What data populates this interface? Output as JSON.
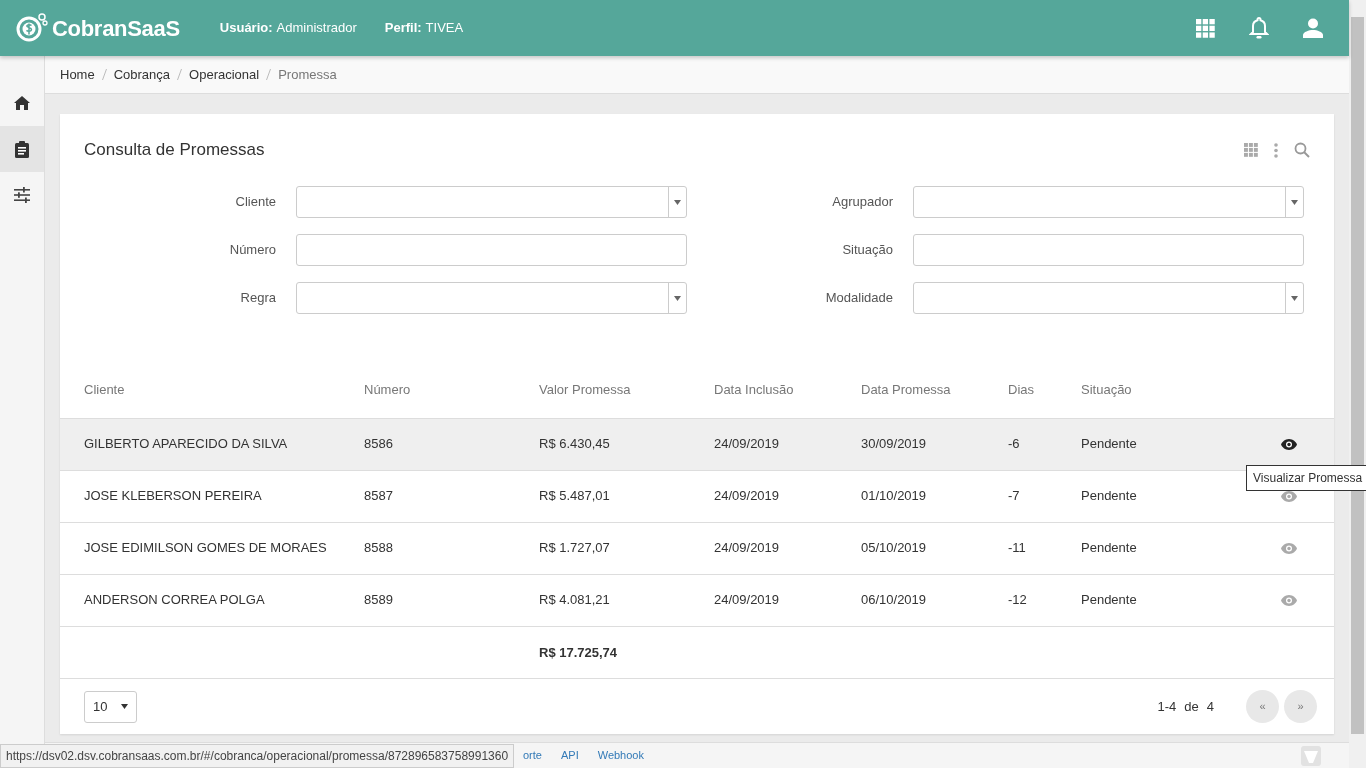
{
  "header": {
    "brand": "CobranSaaS",
    "user_label": "Usuário:",
    "user_value": "Administrador",
    "profile_label": "Perfil:",
    "profile_value": "TIVEA"
  },
  "breadcrumb": [
    {
      "label": "Home",
      "active": false
    },
    {
      "label": "Cobrança",
      "active": false
    },
    {
      "label": "Operacional",
      "active": false
    },
    {
      "label": "Promessa",
      "active": true
    }
  ],
  "sidebar": {
    "items": [
      {
        "kind": "home",
        "selected": false
      },
      {
        "kind": "clipboard",
        "selected": true
      },
      {
        "kind": "sliders",
        "selected": false
      }
    ]
  },
  "card": {
    "title": "Consulta de Promessas"
  },
  "filters": [
    {
      "label": "Cliente",
      "kind": "select"
    },
    {
      "label": "Agrupador",
      "kind": "select"
    },
    {
      "label": "Número",
      "kind": "text"
    },
    {
      "label": "Situação",
      "kind": "text"
    },
    {
      "label": "Regra",
      "kind": "select"
    },
    {
      "label": "Modalidade",
      "kind": "select"
    }
  ],
  "table": {
    "columns": [
      "Cliente",
      "Número",
      "Valor Promessa",
      "Data Inclusão",
      "Data Promessa",
      "Dias",
      "Situação"
    ],
    "rows": [
      {
        "cells": [
          "GILBERTO APARECIDO DA SILVA",
          "8586",
          "R$ 6.430,45",
          "24/09/2019",
          "30/09/2019",
          "-6",
          "Pendente"
        ],
        "hovered": true
      },
      {
        "cells": [
          "JOSE KLEBERSON PEREIRA",
          "8587",
          "R$ 5.487,01",
          "24/09/2019",
          "01/10/2019",
          "-7",
          "Pendente"
        ],
        "hovered": false
      },
      {
        "cells": [
          "JOSE EDIMILSON GOMES DE MORAES",
          "8588",
          "R$ 1.727,07",
          "24/09/2019",
          "05/10/2019",
          "-11",
          "Pendente"
        ],
        "hovered": false
      },
      {
        "cells": [
          "ANDERSON CORREA POLGA",
          "8589",
          "R$ 4.081,21",
          "24/09/2019",
          "06/10/2019",
          "-12",
          "Pendente"
        ],
        "hovered": false
      }
    ],
    "total": "R$ 17.725,74"
  },
  "tooltip": "Visualizar Promessa",
  "pagination": {
    "page_size": "10",
    "range": "1-4",
    "of": "de",
    "total": "4",
    "prev": {
      "label": "«",
      "disabled": true
    },
    "next": {
      "label": "»",
      "disabled": true
    }
  },
  "footer_links": [
    "orte",
    "API",
    "Webhook"
  ],
  "status_url": "https://dsv02.dsv.cobransaas.com.br/#/cobranca/operacional/promessa/872896583758991360"
}
